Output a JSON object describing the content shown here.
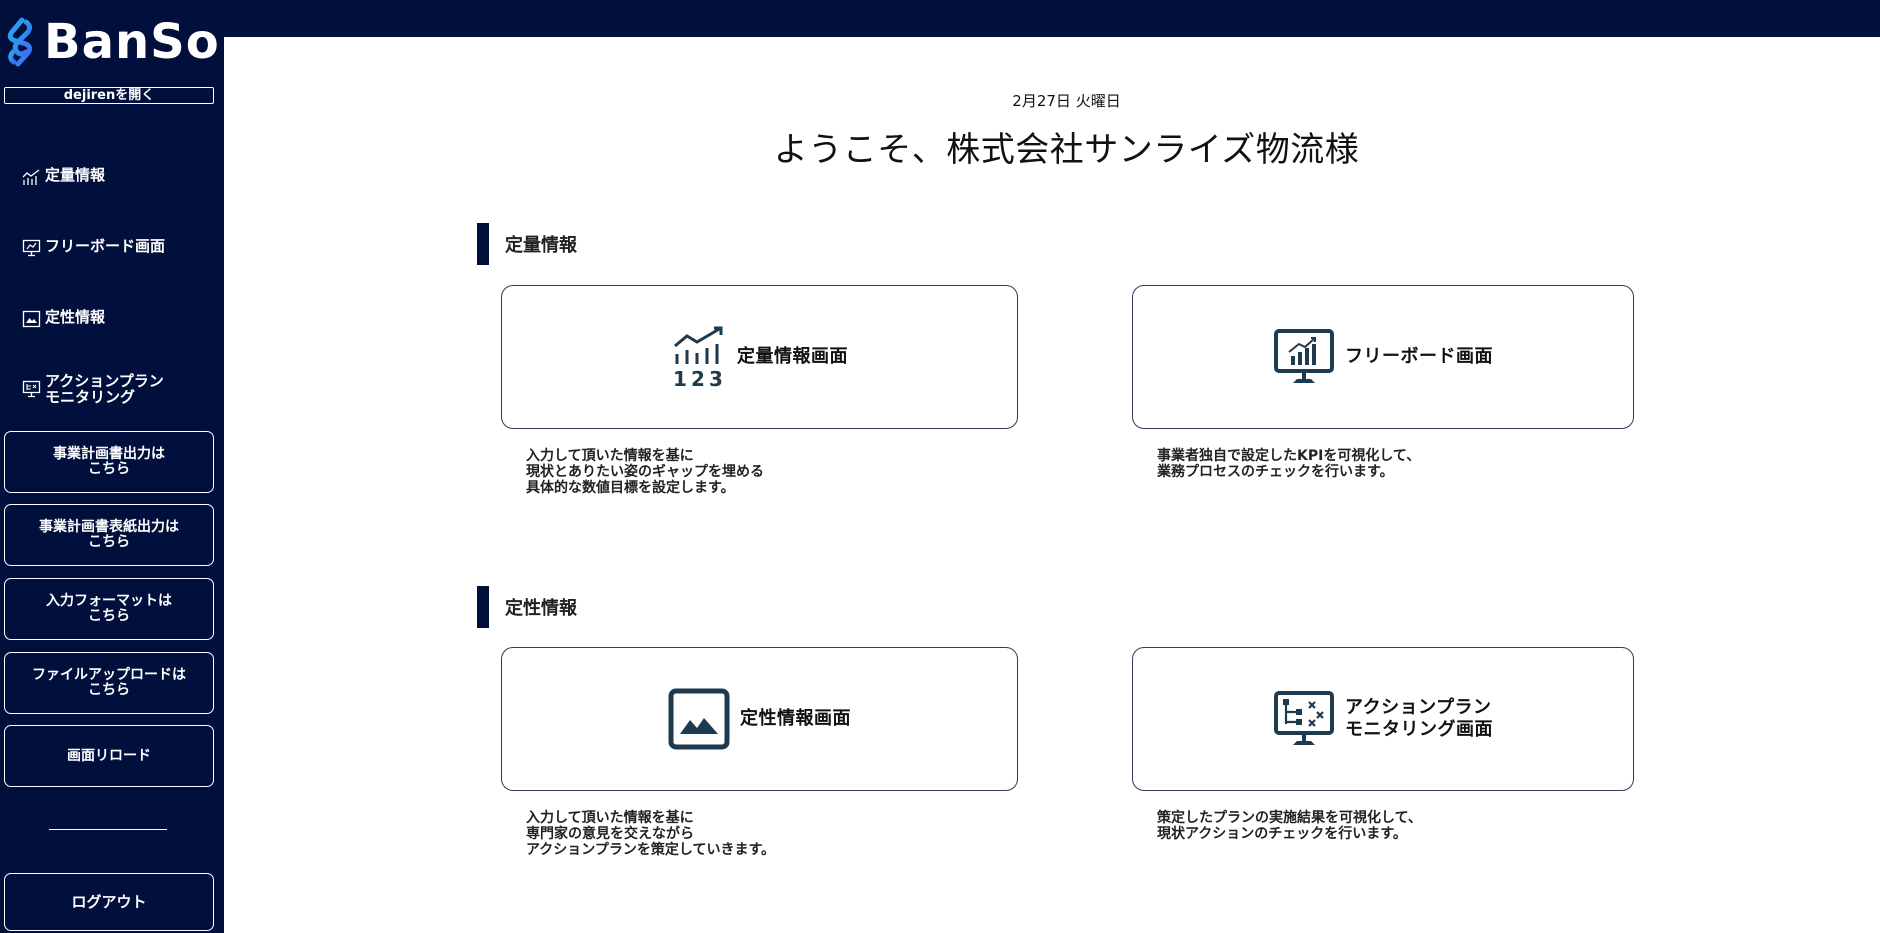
{
  "app": {
    "logo_text": "BanSo",
    "dejiren_label": "dejirenを開く"
  },
  "sidebar": {
    "nav": [
      {
        "label": "定量情報",
        "icon": "chart-icon"
      },
      {
        "label": "フリーボード画面",
        "icon": "monitor-icon"
      },
      {
        "label": "定性情報",
        "icon": "image-icon"
      },
      {
        "label": "アクションプラン\nモニタリング",
        "icon": "flowchart-icon"
      }
    ],
    "buttons": [
      {
        "label": "事業計画書出力は\nこちら"
      },
      {
        "label": "事業計画書表紙出力は\nこちら"
      },
      {
        "label": "入力フォーマットは\nこちら"
      },
      {
        "label": "ファイルアップロードは\nこちら"
      },
      {
        "label": "画面リロード"
      }
    ],
    "logout_label": "ログアウト"
  },
  "main": {
    "date": "2月27日 火曜日",
    "welcome": "ようこそ、株式会社サンライズ物流様",
    "sections": [
      {
        "title": "定量情報",
        "cards": [
          {
            "label": "定量情報画面",
            "icon": "kpi-chart-icon",
            "desc": "入力して頂いた情報を基に\n現状とありたい姿のギャップを埋める\n具体的な数値目標を設定します。"
          },
          {
            "label": "フリーボード画面",
            "icon": "monitor-chart-icon",
            "desc": "事業者独自で設定したKPIを可視化して、\n業務プロセスのチェックを行います。"
          }
        ]
      },
      {
        "title": "定性情報",
        "cards": [
          {
            "label": "定性情報画面",
            "icon": "image-icon",
            "desc": "入力して頂いた情報を基に\n専門家の意見を交えながら\nアクションプランを策定していきます。"
          },
          {
            "label": "アクションプラン\nモニタリング画面",
            "icon": "monitor-flowchart-icon",
            "desc": "策定したプランの実施結果を可視化して、\n現状アクションのチェックを行います。"
          }
        ]
      }
    ]
  },
  "colors": {
    "navy": "#000f3b",
    "accent": "#1e3a4f",
    "logo_gradient_start": "#2aa8f0",
    "logo_gradient_end": "#3b6cf0"
  }
}
